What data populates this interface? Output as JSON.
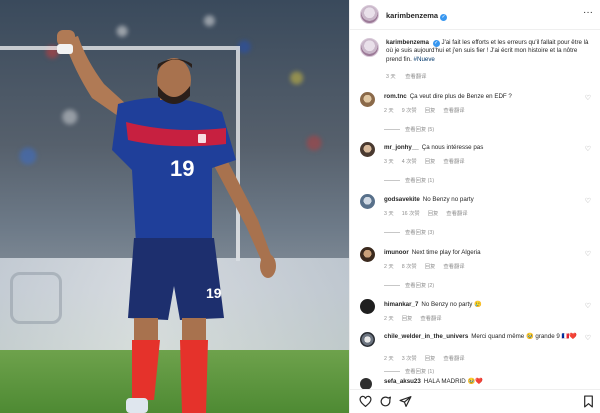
{
  "post": {
    "author": "karimbenzema",
    "caption_text": "J'ai fait les efforts et les erreurs qu'il fallait pour être là où je suis aujourd'hui et j'en suis fier ! J'ai écrit mon histoire et la nôtre prend fin.",
    "hashtag": "#Nueve",
    "caption_age": "3 天",
    "translate_label": "查看翻译"
  },
  "photo": {
    "jersey_number": "19",
    "shorts_number": "19"
  },
  "comments": [
    {
      "username": "rom.tnc",
      "text": "Ça veut dire plus de Benze en EDF ?",
      "age": "2 天",
      "likes": "9 次赞",
      "reply": "回复",
      "translate": "查看翻译",
      "view_replies": "查看回复 (5)"
    },
    {
      "username": "mr_jonhy__",
      "text": "Ça nous intéresse pas",
      "age": "3 天",
      "likes": "4 次赞",
      "reply": "回复",
      "translate": "查看翻译",
      "view_replies": "查看回复 (1)"
    },
    {
      "username": "godsavekite",
      "text": "No Benzy no party",
      "age": "3 天",
      "likes": "16 次赞",
      "reply": "回复",
      "translate": "查看翻译",
      "view_replies": "查看回复 (3)"
    },
    {
      "username": "imunoor",
      "text": "Next time play for Algeria",
      "age": "2 天",
      "likes": "8 次赞",
      "reply": "回复",
      "translate": "查看翻译",
      "view_replies": "查看回复 (2)"
    },
    {
      "username": "himankar_7",
      "text": "No Benzy no party 🥲",
      "age": "2 天",
      "likes": "",
      "reply": "回复",
      "translate": "查看翻译",
      "view_replies": ""
    },
    {
      "username": "chile_welder_in_the_univers",
      "text": "Merci quand même 🥹 grande 9 🇫🇷❤️",
      "age": "2 天",
      "likes": "3 次赞",
      "reply": "回复",
      "translate": "查看翻译",
      "view_replies": "查看回复 (1)"
    },
    {
      "username": "sefa_aksu23",
      "text": "HALA MADRID 🥹❤️",
      "age": "",
      "likes": "",
      "reply": "",
      "translate": "",
      "view_replies": ""
    }
  ],
  "icons": {
    "like": "heart-icon",
    "comment": "comment-icon",
    "share": "share-icon",
    "save": "bookmark-icon",
    "more": "more-icon",
    "verified": "verified-badge-icon",
    "comment_like": "heart-icon"
  },
  "colors": {
    "verified_blue": "#3897f0",
    "hashtag": "#00376b",
    "jersey_blue": "#1f3f9a",
    "jersey_red_band": "#d11f3b",
    "socks_red": "#e5322b"
  }
}
